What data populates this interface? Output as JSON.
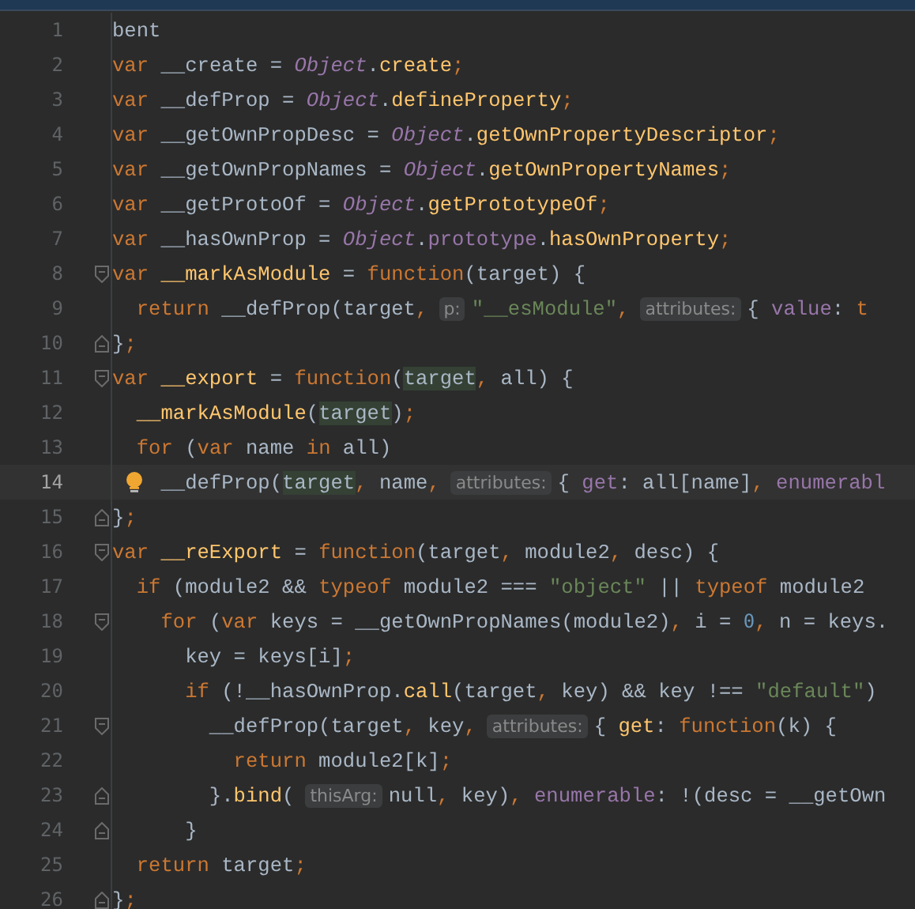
{
  "lines": [
    {
      "number": "1",
      "current": false,
      "bulb": false,
      "fold_start": false,
      "fold_end": false,
      "tokens": [
        {
          "kind": "plain",
          "text": "bent"
        }
      ]
    },
    {
      "number": "2",
      "current": false,
      "bulb": false,
      "fold_start": false,
      "fold_end": false,
      "tokens": [
        {
          "kind": "kw",
          "text": "var"
        },
        {
          "kind": "plain",
          "text": " __create = "
        },
        {
          "kind": "obj",
          "text": "Object"
        },
        {
          "kind": "plain",
          "text": "."
        },
        {
          "kind": "fn",
          "text": "create"
        },
        {
          "kind": "punct",
          "text": ";"
        }
      ]
    },
    {
      "number": "3",
      "current": false,
      "bulb": false,
      "fold_start": false,
      "fold_end": false,
      "tokens": [
        {
          "kind": "kw",
          "text": "var"
        },
        {
          "kind": "plain",
          "text": " __defProp = "
        },
        {
          "kind": "obj",
          "text": "Object"
        },
        {
          "kind": "plain",
          "text": "."
        },
        {
          "kind": "fn",
          "text": "defineProperty"
        },
        {
          "kind": "punct",
          "text": ";"
        }
      ]
    },
    {
      "number": "4",
      "current": false,
      "bulb": false,
      "fold_start": false,
      "fold_end": false,
      "tokens": [
        {
          "kind": "kw",
          "text": "var"
        },
        {
          "kind": "plain",
          "text": " __getOwnPropDesc = "
        },
        {
          "kind": "obj",
          "text": "Object"
        },
        {
          "kind": "plain",
          "text": "."
        },
        {
          "kind": "fn",
          "text": "getOwnPropertyDescriptor"
        },
        {
          "kind": "punct",
          "text": ";"
        }
      ]
    },
    {
      "number": "5",
      "current": false,
      "bulb": false,
      "fold_start": false,
      "fold_end": false,
      "tokens": [
        {
          "kind": "kw",
          "text": "var"
        },
        {
          "kind": "plain",
          "text": " __getOwnPropNames = "
        },
        {
          "kind": "obj",
          "text": "Object"
        },
        {
          "kind": "plain",
          "text": "."
        },
        {
          "kind": "fn",
          "text": "getOwnPropertyNames"
        },
        {
          "kind": "punct",
          "text": ";"
        }
      ]
    },
    {
      "number": "6",
      "current": false,
      "bulb": false,
      "fold_start": false,
      "fold_end": false,
      "tokens": [
        {
          "kind": "kw",
          "text": "var"
        },
        {
          "kind": "plain",
          "text": " __getProtoOf = "
        },
        {
          "kind": "obj",
          "text": "Object"
        },
        {
          "kind": "plain",
          "text": "."
        },
        {
          "kind": "fn",
          "text": "getPrototypeOf"
        },
        {
          "kind": "punct",
          "text": ";"
        }
      ]
    },
    {
      "number": "7",
      "current": false,
      "bulb": false,
      "fold_start": false,
      "fold_end": false,
      "tokens": [
        {
          "kind": "kw",
          "text": "var"
        },
        {
          "kind": "plain",
          "text": " __hasOwnProp = "
        },
        {
          "kind": "obj",
          "text": "Object"
        },
        {
          "kind": "plain",
          "text": "."
        },
        {
          "kind": "prop",
          "text": "prototype"
        },
        {
          "kind": "plain",
          "text": "."
        },
        {
          "kind": "fn",
          "text": "hasOwnProperty"
        },
        {
          "kind": "punct",
          "text": ";"
        }
      ]
    },
    {
      "number": "8",
      "current": false,
      "bulb": false,
      "fold_start": true,
      "fold_end": false,
      "tokens": [
        {
          "kind": "kw",
          "text": "var "
        },
        {
          "kind": "fn",
          "text": "__markAsModule"
        },
        {
          "kind": "plain",
          "text": " = "
        },
        {
          "kind": "kw",
          "text": "function"
        },
        {
          "kind": "plain",
          "text": "(target) {"
        }
      ]
    },
    {
      "number": "9",
      "current": false,
      "bulb": false,
      "fold_start": false,
      "fold_end": false,
      "tokens": [
        {
          "kind": "kw",
          "text": "  return"
        },
        {
          "kind": "plain",
          "text": " __defProp(target"
        },
        {
          "kind": "punct",
          "text": ","
        },
        {
          "kind": "hint",
          "text": "p:"
        },
        {
          "kind": "str",
          "text": "\"__esModule\""
        },
        {
          "kind": "punct",
          "text": ","
        },
        {
          "kind": "hint",
          "text": "attributes:"
        },
        {
          "kind": "plain",
          "text": "{ "
        },
        {
          "kind": "prop",
          "text": "value"
        },
        {
          "kind": "plain",
          "text": ": "
        },
        {
          "kind": "kw",
          "text": "t"
        }
      ]
    },
    {
      "number": "10",
      "current": false,
      "bulb": false,
      "fold_start": false,
      "fold_end": true,
      "tokens": [
        {
          "kind": "plain",
          "text": "}"
        },
        {
          "kind": "punct",
          "text": ";"
        }
      ]
    },
    {
      "number": "11",
      "current": false,
      "bulb": false,
      "fold_start": true,
      "fold_end": false,
      "tokens": [
        {
          "kind": "kw",
          "text": "var "
        },
        {
          "kind": "fn",
          "text": "__export"
        },
        {
          "kind": "plain",
          "text": " = "
        },
        {
          "kind": "kw",
          "text": "function"
        },
        {
          "kind": "plain",
          "text": "("
        },
        {
          "kind": "hl",
          "text": "target"
        },
        {
          "kind": "punct",
          "text": ","
        },
        {
          "kind": "plain",
          "text": " all) {"
        }
      ]
    },
    {
      "number": "12",
      "current": false,
      "bulb": false,
      "fold_start": false,
      "fold_end": false,
      "tokens": [
        {
          "kind": "fn",
          "text": "  __markAsModule"
        },
        {
          "kind": "plain",
          "text": "("
        },
        {
          "kind": "hl",
          "text": "target"
        },
        {
          "kind": "plain",
          "text": ")"
        },
        {
          "kind": "punct",
          "text": ";"
        }
      ]
    },
    {
      "number": "13",
      "current": false,
      "bulb": false,
      "fold_start": false,
      "fold_end": false,
      "tokens": [
        {
          "kind": "kw",
          "text": "  for"
        },
        {
          "kind": "plain",
          "text": " ("
        },
        {
          "kind": "kw",
          "text": "var"
        },
        {
          "kind": "plain",
          "text": " name "
        },
        {
          "kind": "kw",
          "text": "in"
        },
        {
          "kind": "plain",
          "text": " all)"
        }
      ]
    },
    {
      "number": "14",
      "current": true,
      "bulb": true,
      "fold_start": false,
      "fold_end": false,
      "tokens": [
        {
          "kind": "plain",
          "text": "    __defProp("
        },
        {
          "kind": "hl",
          "text": "target"
        },
        {
          "kind": "punct",
          "text": ","
        },
        {
          "kind": "plain",
          "text": " name"
        },
        {
          "kind": "punct",
          "text": ","
        },
        {
          "kind": "hint",
          "text": "attributes:"
        },
        {
          "kind": "plain",
          "text": "{ "
        },
        {
          "kind": "prop",
          "text": "get"
        },
        {
          "kind": "plain",
          "text": ": all[name]"
        },
        {
          "kind": "punct",
          "text": ", "
        },
        {
          "kind": "prop",
          "text": "enumerabl"
        }
      ]
    },
    {
      "number": "15",
      "current": false,
      "bulb": false,
      "fold_start": false,
      "fold_end": true,
      "tokens": [
        {
          "kind": "plain",
          "text": "}"
        },
        {
          "kind": "punct",
          "text": ";"
        }
      ]
    },
    {
      "number": "16",
      "current": false,
      "bulb": false,
      "fold_start": true,
      "fold_end": false,
      "tokens": [
        {
          "kind": "kw",
          "text": "var "
        },
        {
          "kind": "fn",
          "text": "__reExport"
        },
        {
          "kind": "plain",
          "text": " = "
        },
        {
          "kind": "kw",
          "text": "function"
        },
        {
          "kind": "plain",
          "text": "(target"
        },
        {
          "kind": "punct",
          "text": ","
        },
        {
          "kind": "plain",
          "text": " module2"
        },
        {
          "kind": "punct",
          "text": ","
        },
        {
          "kind": "plain",
          "text": " desc) {"
        }
      ]
    },
    {
      "number": "17",
      "current": false,
      "bulb": false,
      "fold_start": false,
      "fold_end": false,
      "tokens": [
        {
          "kind": "kw",
          "text": "  if"
        },
        {
          "kind": "plain",
          "text": " (module2 && "
        },
        {
          "kind": "kw",
          "text": "typeof"
        },
        {
          "kind": "plain",
          "text": " module2 === "
        },
        {
          "kind": "str",
          "text": "\"object\""
        },
        {
          "kind": "plain",
          "text": " || "
        },
        {
          "kind": "kw",
          "text": "typeof"
        },
        {
          "kind": "plain",
          "text": " module2"
        }
      ]
    },
    {
      "number": "18",
      "current": false,
      "bulb": false,
      "fold_start": true,
      "fold_end": false,
      "tokens": [
        {
          "kind": "kw",
          "text": "    for"
        },
        {
          "kind": "plain",
          "text": " ("
        },
        {
          "kind": "kw",
          "text": "var"
        },
        {
          "kind": "plain",
          "text": " keys = __getOwnPropNames(module2)"
        },
        {
          "kind": "punct",
          "text": ","
        },
        {
          "kind": "plain",
          "text": " i = "
        },
        {
          "kind": "num",
          "text": "0"
        },
        {
          "kind": "punct",
          "text": ","
        },
        {
          "kind": "plain",
          "text": " n = keys."
        }
      ]
    },
    {
      "number": "19",
      "current": false,
      "bulb": false,
      "fold_start": false,
      "fold_end": false,
      "tokens": [
        {
          "kind": "plain",
          "text": "      key = keys[i]"
        },
        {
          "kind": "punct",
          "text": ";"
        }
      ]
    },
    {
      "number": "20",
      "current": false,
      "bulb": false,
      "fold_start": false,
      "fold_end": false,
      "tokens": [
        {
          "kind": "kw",
          "text": "      if"
        },
        {
          "kind": "plain",
          "text": " (!__hasOwnProp."
        },
        {
          "kind": "fn",
          "text": "call"
        },
        {
          "kind": "plain",
          "text": "(target"
        },
        {
          "kind": "punct",
          "text": ","
        },
        {
          "kind": "plain",
          "text": " key) && key !== "
        },
        {
          "kind": "str",
          "text": "\"default\""
        },
        {
          "kind": "plain",
          "text": ")"
        }
      ]
    },
    {
      "number": "21",
      "current": false,
      "bulb": false,
      "fold_start": true,
      "fold_end": false,
      "tokens": [
        {
          "kind": "plain",
          "text": "        __defProp(target"
        },
        {
          "kind": "punct",
          "text": ","
        },
        {
          "kind": "plain",
          "text": " key"
        },
        {
          "kind": "punct",
          "text": ","
        },
        {
          "kind": "hint",
          "text": "attributes:"
        },
        {
          "kind": "plain",
          "text": "{ "
        },
        {
          "kind": "fn",
          "text": "get"
        },
        {
          "kind": "plain",
          "text": ": "
        },
        {
          "kind": "kw",
          "text": "function"
        },
        {
          "kind": "plain",
          "text": "(k) {"
        }
      ]
    },
    {
      "number": "22",
      "current": false,
      "bulb": false,
      "fold_start": false,
      "fold_end": false,
      "tokens": [
        {
          "kind": "kw",
          "text": "          return"
        },
        {
          "kind": "plain",
          "text": " module2[k]"
        },
        {
          "kind": "punct",
          "text": ";"
        }
      ]
    },
    {
      "number": "23",
      "current": false,
      "bulb": false,
      "fold_start": false,
      "fold_end": true,
      "tokens": [
        {
          "kind": "plain",
          "text": "        }."
        },
        {
          "kind": "fn",
          "text": "bind"
        },
        {
          "kind": "plain",
          "text": "("
        },
        {
          "kind": "hint",
          "text": "thisArg:"
        },
        {
          "kind": "plain",
          "text": "null"
        },
        {
          "kind": "punct",
          "text": ","
        },
        {
          "kind": "plain",
          "text": " key)"
        },
        {
          "kind": "punct",
          "text": ", "
        },
        {
          "kind": "prop",
          "text": "enumerable"
        },
        {
          "kind": "plain",
          "text": ": !(desc = __getOwn"
        }
      ]
    },
    {
      "number": "24",
      "current": false,
      "bulb": false,
      "fold_start": false,
      "fold_end": true,
      "tokens": [
        {
          "kind": "plain",
          "text": "      }"
        }
      ]
    },
    {
      "number": "25",
      "current": false,
      "bulb": false,
      "fold_start": false,
      "fold_end": false,
      "tokens": [
        {
          "kind": "kw",
          "text": "  return"
        },
        {
          "kind": "plain",
          "text": " target"
        },
        {
          "kind": "punct",
          "text": ";"
        }
      ]
    },
    {
      "number": "26",
      "current": false,
      "bulb": false,
      "fold_start": false,
      "fold_end": true,
      "tokens": [
        {
          "kind": "plain",
          "text": "}"
        },
        {
          "kind": "punct",
          "text": ";"
        }
      ]
    }
  ]
}
